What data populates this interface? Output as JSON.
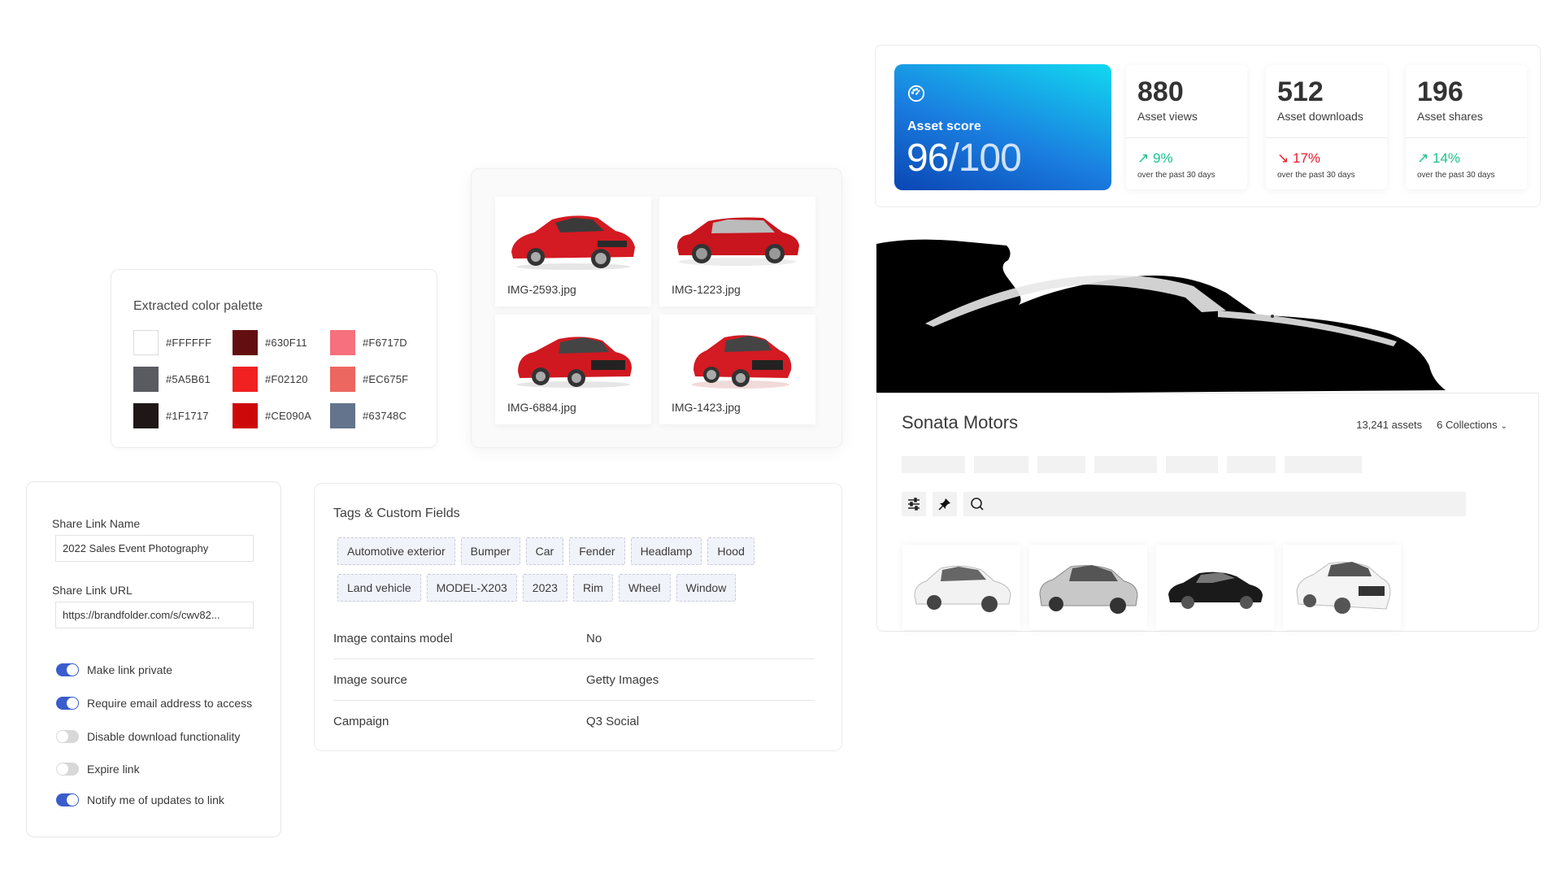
{
  "palette": {
    "title": "Extracted color palette",
    "colors": [
      {
        "hex": "#FFFFFF",
        "label": "#FFFFFF"
      },
      {
        "hex": "#630F11",
        "label": "#630F11"
      },
      {
        "hex": "#F6717D",
        "label": "#F6717D"
      },
      {
        "hex": "#5A5B61",
        "label": "#5A5B61"
      },
      {
        "hex": "#F02120",
        "label": "#F02120"
      },
      {
        "hex": "#EC675F",
        "label": "#EC675F"
      },
      {
        "hex": "#1F1717",
        "label": "#1F1717"
      },
      {
        "hex": "#CE090A",
        "label": "#CE090A"
      },
      {
        "hex": "#63748C",
        "label": "#63748C"
      }
    ]
  },
  "images": {
    "items": [
      {
        "name": "IMG-2593.jpg",
        "icon": "red-hatchback-image"
      },
      {
        "name": "IMG-1223.jpg",
        "icon": "red-suv-image"
      },
      {
        "name": "IMG-6884.jpg",
        "icon": "red-sedan-image"
      },
      {
        "name": "IMG-1423.jpg",
        "icon": "red-sports-sedan-image"
      }
    ]
  },
  "share": {
    "name_label": "Share Link Name",
    "name_value": "2022 Sales Event Photography",
    "url_label": "Share Link URL",
    "url_value": "https://brandfolder.com/s/cwv82...",
    "toggles": [
      {
        "label": "Make link private",
        "on": true
      },
      {
        "label": "Require email address to access",
        "on": true
      },
      {
        "label": "Disable download functionality",
        "on": false
      },
      {
        "label": "Expire link",
        "on": false
      },
      {
        "label": "Notify me of updates to link",
        "on": true
      }
    ],
    "accent_color": "#3A5CCC"
  },
  "tags": {
    "title": "Tags & Custom Fields",
    "items": [
      "Automotive exterior",
      "Bumper",
      "Car",
      "Fender",
      "Headlamp",
      "Hood",
      "Land vehicle",
      "MODEL-X203",
      "2023",
      "Rim",
      "Wheel",
      "Window"
    ],
    "fields": [
      {
        "key": "Image contains model",
        "value": "No"
      },
      {
        "key": "Image source",
        "value": "Getty Images"
      },
      {
        "key": "Campaign",
        "value": "Q3 Social"
      }
    ]
  },
  "stats": {
    "score": {
      "label": "Asset score",
      "value": "96",
      "max": "/100",
      "icon": "gauge-icon"
    },
    "cards": [
      {
        "number": "880",
        "label": "Asset views",
        "delta": "9%",
        "direction": "up",
        "period": "over the past 30 days"
      },
      {
        "number": "512",
        "label": "Asset downloads",
        "delta": "17%",
        "direction": "down",
        "period": "over the past 30 days"
      },
      {
        "number": "196",
        "label": "Asset shares",
        "delta": "14%",
        "direction": "up",
        "period": "over the past 30 days"
      }
    ],
    "up_color": "#19C38C",
    "down_color": "#EE1A2A"
  },
  "brand": {
    "title": "Sonata Motors",
    "asset_count": "13,241 assets",
    "collections": "6 Collections",
    "search_placeholder": "",
    "thumbnails": [
      "white-suv-image",
      "silver-sedan-image",
      "black-sedan-image",
      "white-sports-sedan-image"
    ]
  }
}
